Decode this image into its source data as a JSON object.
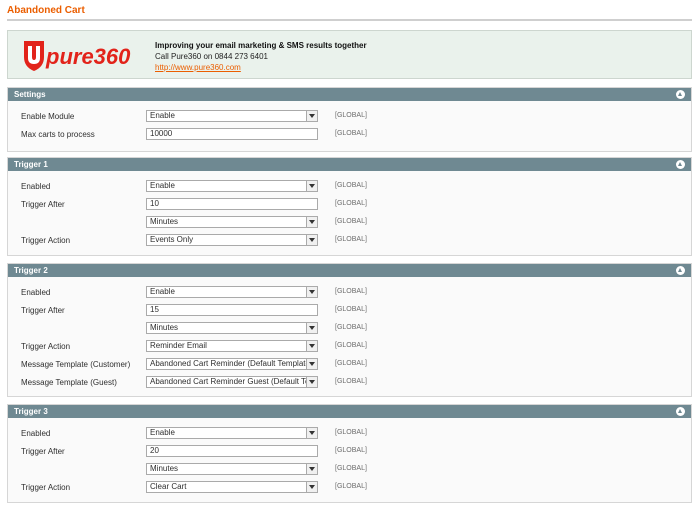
{
  "page": {
    "title": "Abandoned Cart"
  },
  "brand": {
    "logo_text": "pure360",
    "headline": "Improving your email marketing & SMS results together",
    "phone": "Call Pure360 on 0844 273 6401",
    "link": "http://www.pure360.com"
  },
  "scope_label": "[GLOBAL]",
  "sections": {
    "settings": {
      "title": "Settings",
      "enable_module": {
        "label": "Enable Module",
        "value": "Enable"
      },
      "max_carts": {
        "label": "Max carts to process",
        "value": "10000"
      }
    },
    "trigger1": {
      "title": "Trigger 1",
      "enabled": {
        "label": "Enabled",
        "value": "Enable"
      },
      "trigger_after": {
        "label": "Trigger After",
        "value": "10",
        "unit": "Minutes"
      },
      "trigger_action": {
        "label": "Trigger Action",
        "value": "Events Only"
      }
    },
    "trigger2": {
      "title": "Trigger 2",
      "enabled": {
        "label": "Enabled",
        "value": "Enable"
      },
      "trigger_after": {
        "label": "Trigger After",
        "value": "15",
        "unit": "Minutes"
      },
      "trigger_action": {
        "label": "Trigger Action",
        "value": "Reminder Email"
      },
      "template_customer": {
        "label": "Message Template (Customer)",
        "value": "Abandoned Cart Reminder (Default Template from"
      },
      "template_guest": {
        "label": "Message Template (Guest)",
        "value": "Abandoned Cart Reminder Guest (Default Template"
      }
    },
    "trigger3": {
      "title": "Trigger 3",
      "enabled": {
        "label": "Enabled",
        "value": "Enable"
      },
      "trigger_after": {
        "label": "Trigger After",
        "value": "20",
        "unit": "Minutes"
      },
      "trigger_action": {
        "label": "Trigger Action",
        "value": "Clear Cart"
      }
    }
  },
  "colors": {
    "accent": "#eb5e00",
    "section_header": "#6f8992",
    "brand_red": "#e2231a"
  }
}
